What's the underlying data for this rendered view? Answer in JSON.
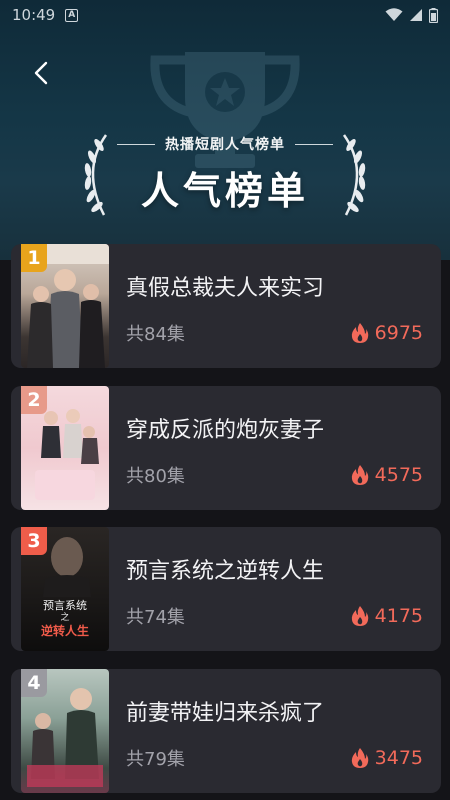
{
  "status_bar": {
    "time": "10:49"
  },
  "header": {
    "subtitle": "热播短剧人气榜单",
    "title": "人气榜单"
  },
  "colors": {
    "rank1": "#e8a41c",
    "rank2": "#e79a8a",
    "rank3": "#ef5d4a",
    "rank4": "#9a9aa0",
    "heat": "#f26a5a"
  },
  "items": [
    {
      "rank": "1",
      "title": "真假总裁夫人来实习",
      "episodes": "共84集",
      "heat": "6975"
    },
    {
      "rank": "2",
      "title": "穿成反派的炮灰妻子",
      "episodes": "共80集",
      "heat": "4575"
    },
    {
      "rank": "3",
      "title": "预言系统之逆转人生",
      "episodes": "共74集",
      "heat": "4175",
      "cover_text_1": "预言系统",
      "cover_text_2": "之",
      "cover_text_3": "逆转人生"
    },
    {
      "rank": "4",
      "title": "前妻带娃归来杀疯了",
      "episodes": "共79集",
      "heat": "3475"
    }
  ]
}
